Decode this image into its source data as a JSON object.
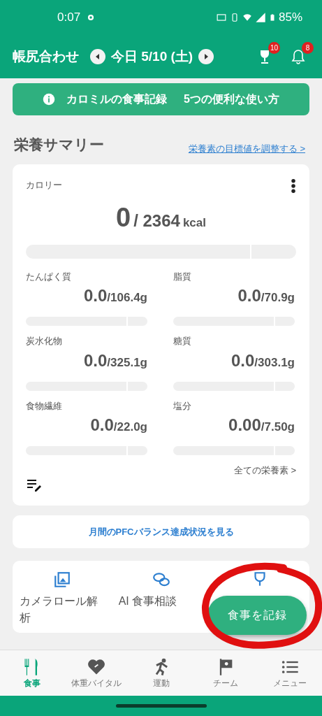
{
  "status_bar": {
    "time": "0:07",
    "battery": "85%"
  },
  "header": {
    "title": "帳尻合わせ",
    "date": "今日 5/10 (土)",
    "trophy_badge": "10",
    "bell_badge": "8"
  },
  "banner": {
    "title": "カロミルの食事記録",
    "subtitle": "5つの便利な使い方"
  },
  "summary": {
    "title": "栄養サマリー",
    "link": "栄養素の目標値を調整する >",
    "calorie": {
      "label": "カロリー",
      "value": "0",
      "target": "/ 2364",
      "unit": "kcal"
    },
    "nutrients": [
      {
        "label": "たんぱく質",
        "value": "0.0",
        "target": "/106.4g"
      },
      {
        "label": "脂質",
        "value": "0.0",
        "target": "/70.9g"
      },
      {
        "label": "炭水化物",
        "value": "0.0",
        "target": "/325.1g"
      },
      {
        "label": "糖質",
        "value": "0.0",
        "target": "/303.1g"
      },
      {
        "label": "食物繊維",
        "value": "0.0",
        "target": "/22.0g"
      },
      {
        "label": "塩分",
        "value": "0.00",
        "target": "/7.50g"
      }
    ],
    "all_link": "全ての栄養素 >"
  },
  "pfc_button": "月間のPFCバランス達成状況を見る",
  "quick_actions": [
    {
      "kind": "gallery",
      "label": "カメラロール解析"
    },
    {
      "kind": "chat",
      "label": "AI 食事相談"
    },
    {
      "kind": "trophy"
    }
  ],
  "fab": "食事を記録",
  "nav": [
    {
      "kind": "meal",
      "label": "食事",
      "selected": true
    },
    {
      "kind": "heart",
      "label": "体重バイタル",
      "selected": false
    },
    {
      "kind": "run",
      "label": "運動",
      "selected": false
    },
    {
      "kind": "flag",
      "label": "チーム",
      "selected": false
    },
    {
      "kind": "menu",
      "label": "メニュー",
      "selected": false
    }
  ]
}
